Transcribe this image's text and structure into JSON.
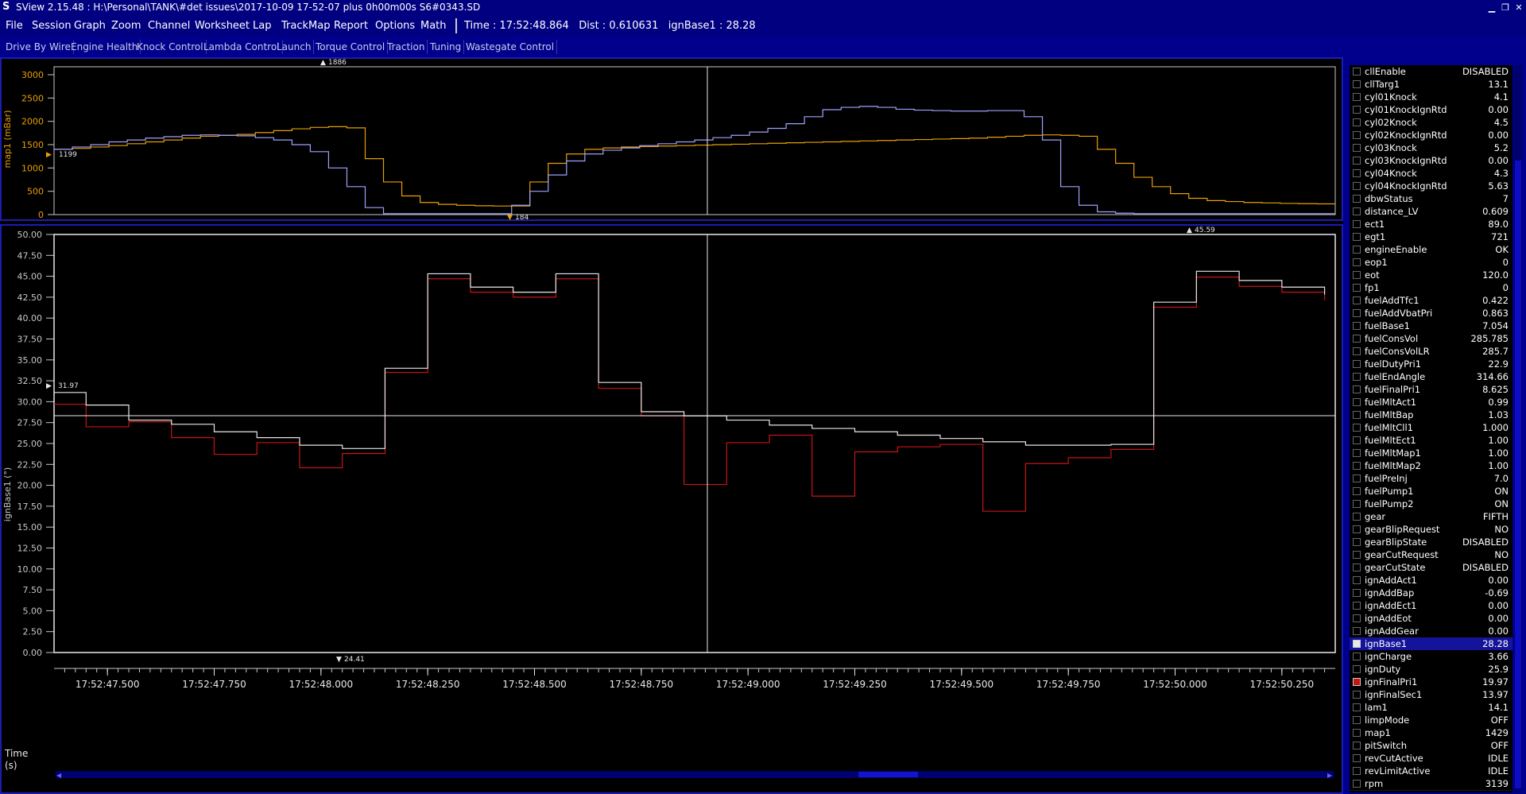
{
  "window": {
    "title": "SView 2.15.48  :  H:\\Personal\\TANK\\#det issues\\2017-10-09 17-52-07 plus 0h00m00s S6#0343.SD",
    "app_icon": "sview-logo-icon"
  },
  "menu": [
    "File",
    "Session",
    "Graph",
    "Zoom",
    "Channel",
    "Worksheet",
    "Lap",
    "TrackMap",
    "Report",
    "Options",
    "Math"
  ],
  "status": {
    "time": "Time : 17:52:48.864",
    "dist": "Dist : 0.610631",
    "cursor": "ignBase1 : 28.28"
  },
  "worksheets": [
    "Drive By Wire",
    "Engine Health",
    "Knock Control",
    "Lambda Control",
    "Launch",
    "Torque Control",
    "Traction",
    "Tuning",
    "Wastegate Control"
  ],
  "colors": {
    "bg": "#000000",
    "chrome": "#000080",
    "orange": "#e8a000",
    "lavender": "#a0a0ff",
    "red": "#c81414",
    "white": "#e8e8e8",
    "axis": "#c8c8c8"
  },
  "top_chart": {
    "ylabel": "map1 (mBar)",
    "yticks": [
      "3000",
      "2500",
      "2000",
      "1500",
      "1000",
      "500",
      "0"
    ],
    "max_marker": "1886",
    "min_marker": "184",
    "left_marker": "1199"
  },
  "bottom_chart": {
    "ylabel": "ignBase1 (°)",
    "yticks": [
      "50.00",
      "47.50",
      "45.00",
      "42.50",
      "40.00",
      "37.50",
      "35.00",
      "32.50",
      "30.00",
      "27.50",
      "25.00",
      "22.50",
      "20.00",
      "17.50",
      "15.00",
      "12.50",
      "10.00",
      "7.50",
      "5.00",
      "2.50",
      "0.00"
    ],
    "max_marker": "45.59",
    "min_marker": "24.41",
    "left_marker": "31.97",
    "xlabel_line1": "Time",
    "xlabel_line2": "(s)",
    "xticks": [
      "17:52:47.500",
      "17:52:47.750",
      "17:52:48.000",
      "17:52:48.250",
      "17:52:48.500",
      "17:52:48.750",
      "17:52:49.000",
      "17:52:49.250",
      "17:52:49.500",
      "17:52:49.750",
      "17:52:50.000",
      "17:52:50.250"
    ]
  },
  "chart_data": [
    {
      "type": "line",
      "ylabel": "map1 (mBar)",
      "ylim": [
        0,
        3000
      ],
      "x": [
        0,
        1,
        2,
        3,
        4,
        5,
        6,
        7,
        8,
        9,
        10,
        11,
        12,
        13,
        14,
        15,
        16,
        17,
        18,
        19,
        20,
        21,
        22,
        23,
        24,
        25,
        26,
        27,
        28,
        29,
        30,
        31,
        32,
        33,
        34,
        35,
        36,
        37,
        38,
        39,
        40,
        41,
        42,
        43,
        44,
        45,
        46,
        47,
        48,
        49,
        50,
        51,
        52,
        53,
        54,
        55,
        56,
        57,
        58,
        59,
        60,
        61,
        62,
        63,
        64,
        65,
        66,
        67,
        68,
        69,
        70
      ],
      "series": [
        {
          "color": "#e8a000",
          "values": [
            1400,
            1420,
            1450,
            1480,
            1520,
            1560,
            1600,
            1640,
            1680,
            1700,
            1720,
            1760,
            1800,
            1840,
            1870,
            1886,
            1860,
            1200,
            700,
            400,
            260,
            220,
            200,
            190,
            184,
            184,
            700,
            1100,
            1300,
            1400,
            1430,
            1450,
            1460,
            1470,
            1480,
            1490,
            1500,
            1510,
            1520,
            1530,
            1540,
            1550,
            1560,
            1570,
            1580,
            1590,
            1600,
            1610,
            1620,
            1630,
            1640,
            1660,
            1680,
            1700,
            1710,
            1700,
            1680,
            1400,
            1100,
            800,
            600,
            450,
            350,
            300,
            280,
            260,
            250,
            240,
            235,
            230,
            230
          ]
        },
        {
          "color": "#a0a0ff",
          "values": [
            1400,
            1450,
            1500,
            1560,
            1600,
            1640,
            1670,
            1700,
            1710,
            1700,
            1690,
            1650,
            1600,
            1500,
            1350,
            1000,
            600,
            150,
            20,
            20,
            20,
            20,
            20,
            20,
            20,
            200,
            500,
            850,
            1150,
            1300,
            1380,
            1430,
            1480,
            1520,
            1560,
            1600,
            1650,
            1700,
            1770,
            1850,
            1950,
            2100,
            2250,
            2300,
            2320,
            2300,
            2260,
            2240,
            2230,
            2220,
            2220,
            2230,
            2230,
            2100,
            1600,
            600,
            200,
            60,
            30,
            20,
            20,
            20,
            20,
            20,
            20,
            20,
            20,
            20,
            20,
            20,
            20
          ]
        }
      ]
    },
    {
      "type": "line",
      "ylabel": "ignBase1 (°)",
      "xlabel": "Time (s)",
      "x_start": "17:52:47.375",
      "x_end": "17:52:50.375",
      "ylim": [
        0,
        50
      ],
      "series": [
        {
          "name": "ignBase1",
          "color": "#e8e8e8",
          "x": [
            47.375,
            47.45,
            47.55,
            47.65,
            47.75,
            47.85,
            47.95,
            48.05,
            48.15,
            48.25,
            48.35,
            48.45,
            48.55,
            48.65,
            48.75,
            48.85,
            48.95,
            49.05,
            49.15,
            49.25,
            49.35,
            49.45,
            49.55,
            49.65,
            49.75,
            49.85,
            49.95,
            50.05,
            50.15,
            50.25,
            50.35
          ],
          "values": [
            31.1,
            29.6,
            27.8,
            27.3,
            26.4,
            25.7,
            24.8,
            24.4,
            34.0,
            45.3,
            43.7,
            43.1,
            45.3,
            32.3,
            28.8,
            28.3,
            27.8,
            27.2,
            26.8,
            26.4,
            26.0,
            25.6,
            25.2,
            24.8,
            24.8,
            24.9,
            41.9,
            45.6,
            44.5,
            43.7,
            42.8
          ]
        },
        {
          "name": "ignFinalPri1",
          "color": "#c81414",
          "x": [
            47.375,
            47.45,
            47.55,
            47.65,
            47.75,
            47.85,
            47.95,
            48.05,
            48.15,
            48.25,
            48.35,
            48.45,
            48.55,
            48.65,
            48.75,
            48.85,
            48.95,
            49.05,
            49.15,
            49.25,
            49.35,
            49.45,
            49.55,
            49.65,
            49.75,
            49.85,
            49.95,
            50.05,
            50.15,
            50.25,
            50.35
          ],
          "values": [
            29.7,
            27.0,
            27.6,
            25.7,
            23.7,
            25.1,
            22.1,
            23.8,
            33.5,
            44.7,
            43.1,
            42.5,
            44.7,
            31.6,
            28.3,
            20.1,
            25.1,
            26.0,
            18.7,
            24.0,
            24.6,
            24.9,
            16.9,
            22.6,
            23.3,
            24.3,
            41.3,
            44.9,
            43.8,
            43.1,
            42.1
          ]
        }
      ]
    }
  ],
  "channels": [
    {
      "name": "cllEnable",
      "value": "DISABLED"
    },
    {
      "name": "cllTarg1",
      "value": "13.1"
    },
    {
      "name": "cyl01Knock",
      "value": "4.1"
    },
    {
      "name": "cyl01KnockIgnRtd",
      "value": "0.00"
    },
    {
      "name": "cyl02Knock",
      "value": "4.5"
    },
    {
      "name": "cyl02KnockIgnRtd",
      "value": "0.00"
    },
    {
      "name": "cyl03Knock",
      "value": "5.2"
    },
    {
      "name": "cyl03KnockIgnRtd",
      "value": "0.00"
    },
    {
      "name": "cyl04Knock",
      "value": "4.3"
    },
    {
      "name": "cyl04KnockIgnRtd",
      "value": "5.63"
    },
    {
      "name": "dbwStatus",
      "value": "7"
    },
    {
      "name": "distance_LV",
      "value": "0.609"
    },
    {
      "name": "ect1",
      "value": "89.0"
    },
    {
      "name": "egt1",
      "value": "721"
    },
    {
      "name": "engineEnable",
      "value": "OK"
    },
    {
      "name": "eop1",
      "value": "0"
    },
    {
      "name": "eot",
      "value": "120.0"
    },
    {
      "name": "fp1",
      "value": "0"
    },
    {
      "name": "fuelAddTfc1",
      "value": "0.422"
    },
    {
      "name": "fuelAddVbatPri",
      "value": "0.863"
    },
    {
      "name": "fuelBase1",
      "value": "7.054"
    },
    {
      "name": "fuelConsVol",
      "value": "285.785"
    },
    {
      "name": "fuelConsVolLR",
      "value": "285.7"
    },
    {
      "name": "fuelDutyPri1",
      "value": "22.9"
    },
    {
      "name": "fuelEndAngle",
      "value": "314.66"
    },
    {
      "name": "fuelFinalPri1",
      "value": "8.625"
    },
    {
      "name": "fuelMltAct1",
      "value": "0.99"
    },
    {
      "name": "fuelMltBap",
      "value": "1.03"
    },
    {
      "name": "fuelMltCll1",
      "value": "1.000"
    },
    {
      "name": "fuelMltEct1",
      "value": "1.00"
    },
    {
      "name": "fuelMltMap1",
      "value": "1.00"
    },
    {
      "name": "fuelMltMap2",
      "value": "1.00"
    },
    {
      "name": "fuelPreInj",
      "value": "7.0"
    },
    {
      "name": "fuelPump1",
      "value": "ON"
    },
    {
      "name": "fuelPump2",
      "value": "ON"
    },
    {
      "name": "gear",
      "value": "FIFTH"
    },
    {
      "name": "gearBlipRequest",
      "value": "NO"
    },
    {
      "name": "gearBlipState",
      "value": "DISABLED"
    },
    {
      "name": "gearCutRequest",
      "value": "NO"
    },
    {
      "name": "gearCutState",
      "value": "DISABLED"
    },
    {
      "name": "ignAddAct1",
      "value": "0.00"
    },
    {
      "name": "ignAddBap",
      "value": "-0.69"
    },
    {
      "name": "ignAddEct1",
      "value": "0.00"
    },
    {
      "name": "ignAddEot",
      "value": "0.00"
    },
    {
      "name": "ignAddGear",
      "value": "0.00"
    },
    {
      "name": "ignBase1",
      "value": "28.28",
      "checked_color": "#e8e8e8",
      "selected": true
    },
    {
      "name": "ignCharge",
      "value": "3.66"
    },
    {
      "name": "ignDuty",
      "value": "25.9"
    },
    {
      "name": "ignFinalPri1",
      "value": "19.97",
      "checked_color": "#c81414"
    },
    {
      "name": "ignFinalSec1",
      "value": "13.97"
    },
    {
      "name": "lam1",
      "value": "14.1"
    },
    {
      "name": "limpMode",
      "value": "OFF"
    },
    {
      "name": "map1",
      "value": "1429"
    },
    {
      "name": "pitSwitch",
      "value": "OFF"
    },
    {
      "name": "revCutActive",
      "value": "IDLE"
    },
    {
      "name": "revLimitActive",
      "value": "IDLE"
    },
    {
      "name": "rpm",
      "value": "3139"
    }
  ]
}
